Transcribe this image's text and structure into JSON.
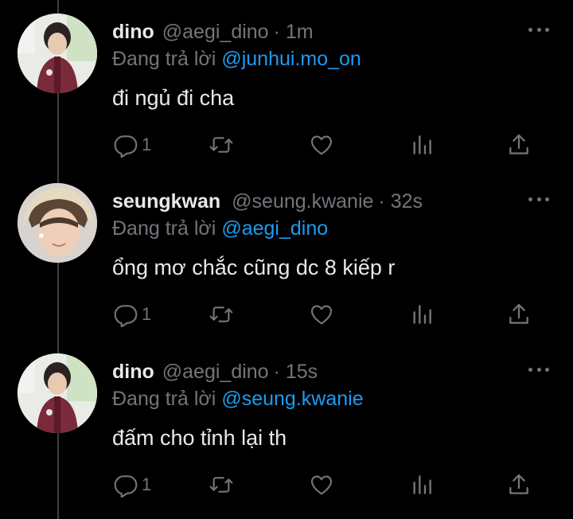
{
  "tweets": [
    {
      "name": "dino",
      "handle": "@aegi_dino",
      "time": "· 1m",
      "reply_label": "Đang trả lời",
      "reply_to": "@junhui.mo_on",
      "text": "đi ngủ đi cha",
      "reply_count": "1",
      "avatar_icon": "avatar-dino"
    },
    {
      "name": "seungkwan",
      "handle": "@seung.kwanie",
      "time": "· 32s",
      "reply_label": "Đang trả lời",
      "reply_to": "@aegi_dino",
      "text": "ổng mơ chắc cũng dc 8 kiếp r",
      "reply_count": "1",
      "avatar_icon": "avatar-seungkwan"
    },
    {
      "name": "dino",
      "handle": "@aegi_dino",
      "time": "· 15s",
      "reply_label": "Đang trả lời",
      "reply_to": "@seung.kwanie",
      "text": "đấm cho tỉnh lại th",
      "reply_count": "1",
      "avatar_icon": "avatar-dino"
    }
  ],
  "colors": {
    "background": "#000000",
    "text": "#e7e9ea",
    "secondary": "#71767b",
    "link": "#1d9bf0"
  },
  "icons": [
    "reply-icon",
    "retweet-icon",
    "like-icon",
    "stats-icon",
    "share-icon",
    "more-icon"
  ]
}
